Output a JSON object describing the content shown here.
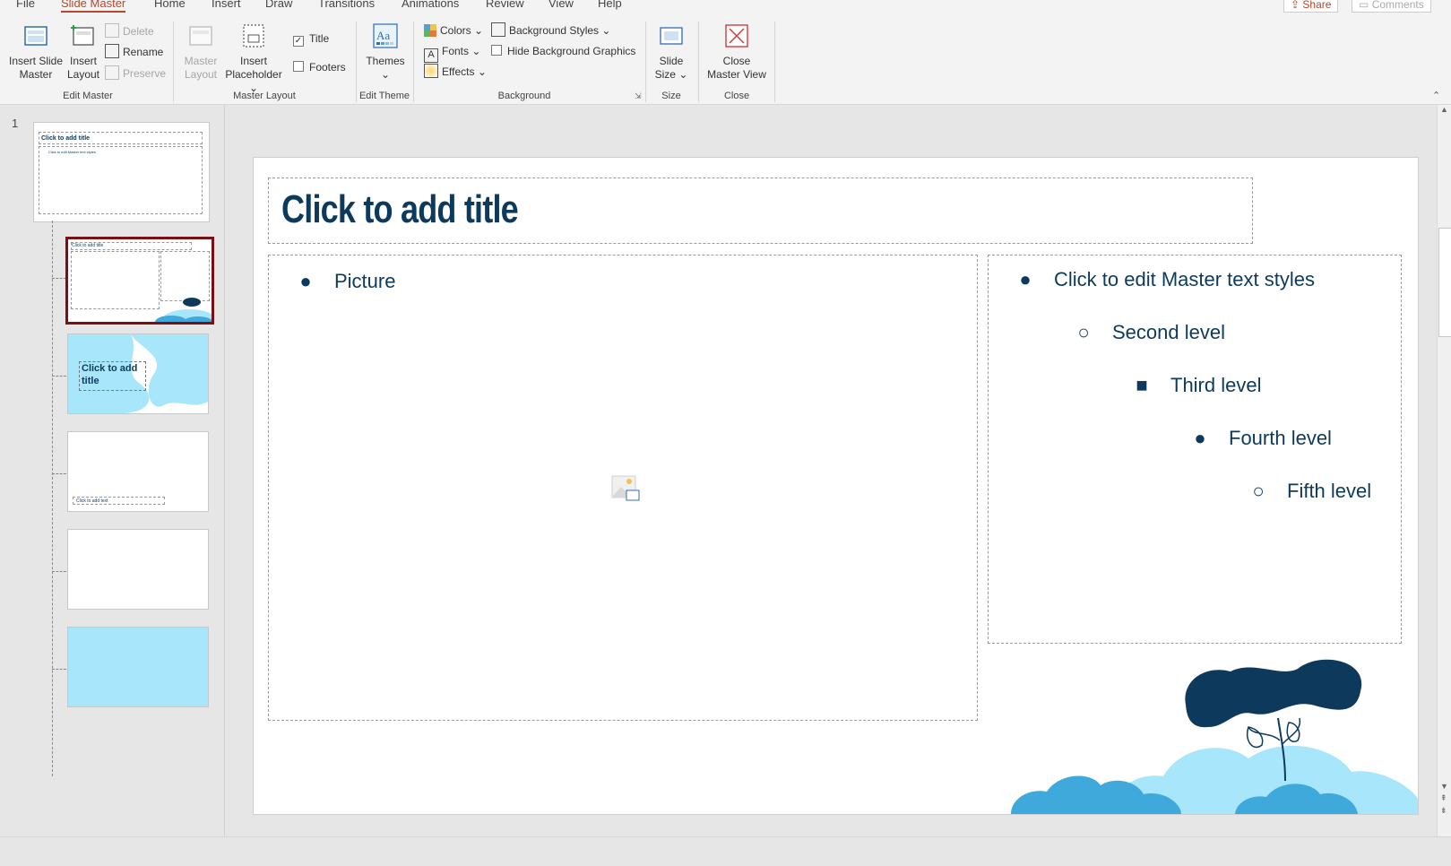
{
  "tabs": [
    "File",
    "Slide Master",
    "Home",
    "Insert",
    "Draw",
    "Transitions",
    "Animations",
    "Review",
    "View",
    "Help"
  ],
  "share_label": "Share",
  "comments_label": "Comments",
  "ribbon": {
    "edit_master": {
      "insert_slide_master": "Insert Slide\nMaster",
      "insert_slide_master_l1": "Insert Slide",
      "insert_slide_master_l2": "Master",
      "insert_layout_l1": "Insert",
      "insert_layout_l2": "Layout",
      "delete": "Delete",
      "rename": "Rename",
      "preserve": "Preserve",
      "label": "Edit Master"
    },
    "master_layout": {
      "master_layout_l1": "Master",
      "master_layout_l2": "Layout",
      "insert_placeholder_l1": "Insert",
      "insert_placeholder_l2": "Placeholder",
      "title_check": "Title",
      "footers_check": "Footers",
      "label": "Master Layout"
    },
    "edit_theme": {
      "themes": "Themes",
      "label": "Edit Theme"
    },
    "background": {
      "colors": "Colors",
      "fonts": "Fonts",
      "effects": "Effects",
      "background_styles": "Background Styles",
      "hide_background_graphics": "Hide Background Graphics",
      "label": "Background"
    },
    "size": {
      "slide_size_l1": "Slide",
      "slide_size_l2": "Size",
      "label": "Size"
    },
    "close": {
      "close_l1": "Close",
      "close_l2": "Master View",
      "label": "Close"
    }
  },
  "thumbnails": {
    "slide_number": "1",
    "master_title": "Click to add title",
    "master_body": "Click to edit Master text styles",
    "layout3_title": "Click to add title",
    "layout4_text": "Click to add text"
  },
  "slide": {
    "title": "Click to add title",
    "picture_item": "Picture",
    "levels": [
      "Click to edit Master text styles",
      "Second level",
      "Third level",
      "Fourth level",
      "Fifth level"
    ]
  },
  "colors": {
    "accent": "#b7472a",
    "title_navy": "#0d3a5c",
    "light_blue": "#a7e6fb",
    "mid_blue": "#3fa9dc",
    "dark_red": "#7a0f14"
  }
}
